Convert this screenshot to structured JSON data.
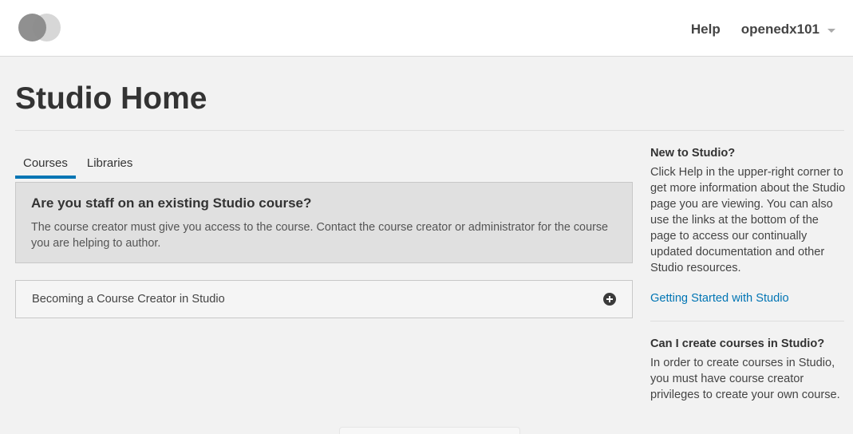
{
  "header": {
    "help_label": "Help",
    "username": "openedx101"
  },
  "page": {
    "title": "Studio Home"
  },
  "tabs": [
    {
      "label": "Courses",
      "active": true
    },
    {
      "label": "Libraries",
      "active": false
    }
  ],
  "staff_notice": {
    "title": "Are you staff on an existing Studio course?",
    "body": "The course creator must give you access to the course. Contact the course creator or administrator for the course you are helping to author."
  },
  "course_creator": {
    "label": "Becoming a Course Creator in Studio",
    "icon": "plus-circle-icon"
  },
  "sidebar": {
    "new_title": "New to Studio?",
    "new_body": "Click Help in the upper-right corner to get more information about the Studio page you are viewing. You can also use the links at the bottom of the page to access our continually updated documentation and other Studio resources.",
    "getting_started_link": "Getting Started with Studio",
    "create_title": "Can I create courses in Studio?",
    "create_body": "In order to create courses in Studio, you must have course creator privileges to create your own course."
  },
  "colors": {
    "accent": "#0075b4",
    "background": "#f2f2f2"
  }
}
